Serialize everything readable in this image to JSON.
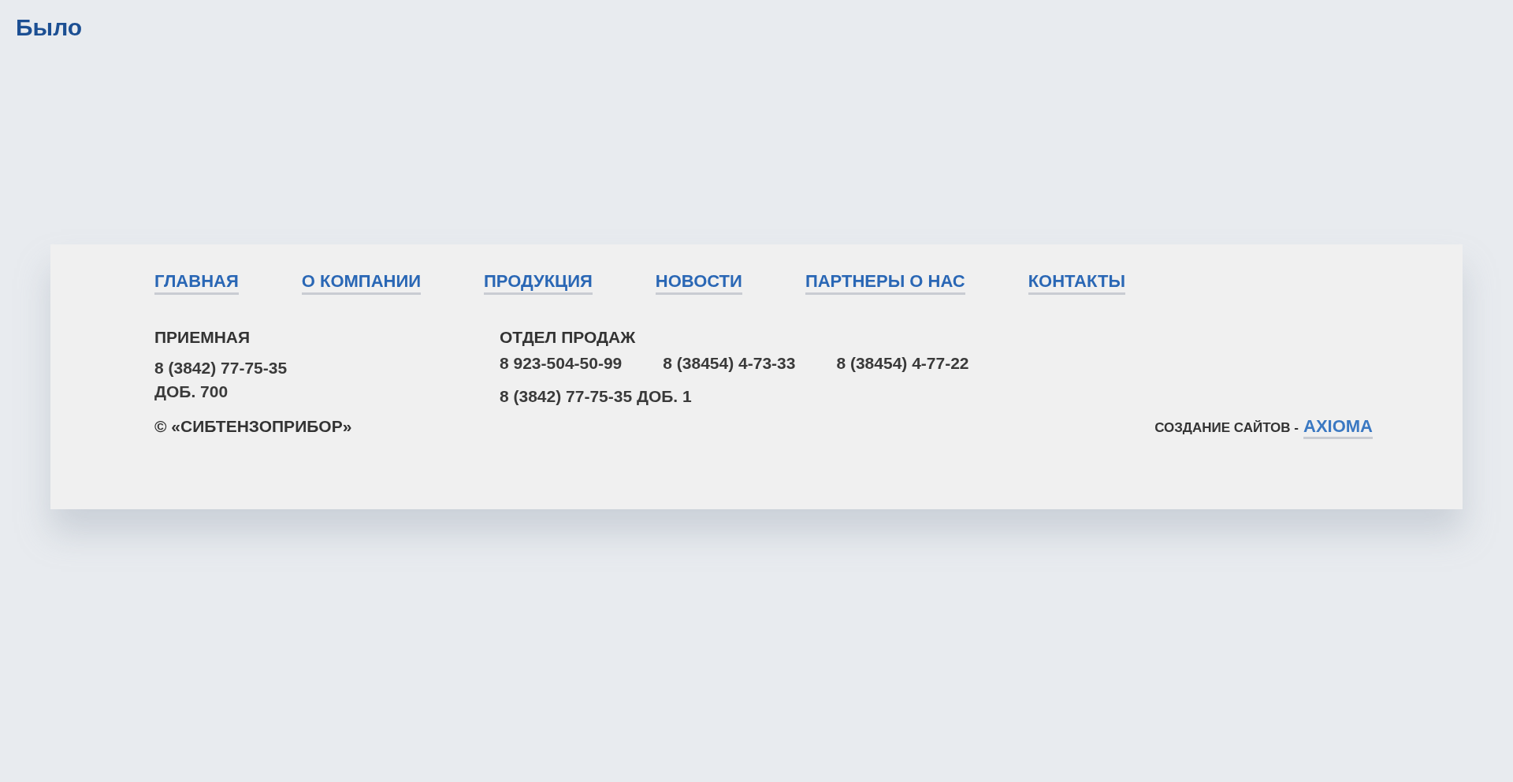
{
  "heading": "Было",
  "footer": {
    "nav": [
      "ГЛАВНАЯ",
      "О КОМПАНИИ",
      "ПРОДУКЦИЯ",
      "НОВОСТИ",
      "ПАРТНЕРЫ О НАС",
      "КОНТАКТЫ"
    ],
    "reception": {
      "title": "ПРИЕМНАЯ",
      "lines": [
        "8 (3842) 77-75-35",
        "ДОБ. 700"
      ]
    },
    "sales": {
      "title": "ОТДЕЛ ПРОДАЖ",
      "phones": [
        "8 923-504-50-99",
        "8 (38454) 4-73-33",
        "8 (38454) 4-77-22"
      ],
      "extra": "8 (3842) 77-75-35 ДОБ. 1"
    },
    "copyright": "© «СИБТЕНЗОПРИБОР»",
    "credit": {
      "label": "СОЗДАНИЕ САЙТОВ -",
      "link": "AXIOMA"
    }
  }
}
